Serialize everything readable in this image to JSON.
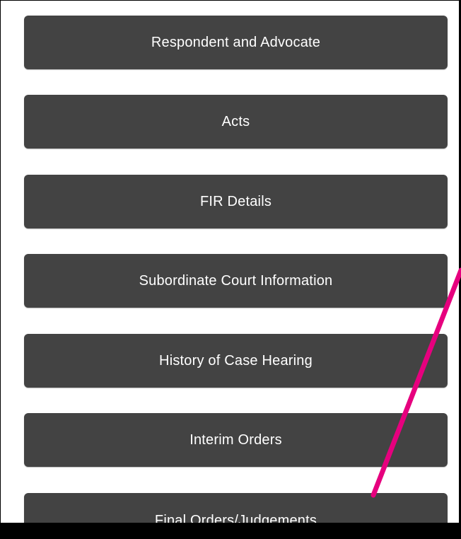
{
  "menu": {
    "items": [
      {
        "label": "Respondent and Advocate"
      },
      {
        "label": "Acts"
      },
      {
        "label": "FIR Details"
      },
      {
        "label": "Subordinate Court Information"
      },
      {
        "label": "History of Case Hearing"
      },
      {
        "label": "Interim Orders"
      },
      {
        "label": "Final Orders/Judgements"
      }
    ]
  },
  "colors": {
    "button_bg": "#434343",
    "button_text": "#ffffff",
    "page_bg": "#ffffff",
    "annotation_arrow": "#e6007e"
  },
  "annotation": {
    "icon": "pointer-arrow-icon"
  }
}
